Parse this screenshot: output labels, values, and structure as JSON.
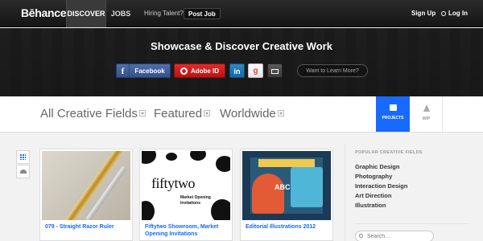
{
  "topnav": {
    "logo": "Bēhance",
    "discover": "DISCOVER",
    "jobs": "JOBS",
    "hiring": "Hiring Talent?",
    "post_job": "Post Job",
    "sign_up": "Sign Up",
    "log_in": "Log In"
  },
  "hero": {
    "title": "Showcase & Discover Creative Work",
    "facebook_glyph": "f",
    "facebook": "Facebook",
    "adobe": "Adobe ID",
    "linkedin": "in",
    "google": "g",
    "learn_more": "Want to Learn More?"
  },
  "filters": {
    "fields": "All Creative Fields",
    "featured": "Featured",
    "location": "Worldwide"
  },
  "tabs": {
    "projects": "PROJECTS",
    "wip": "WIP"
  },
  "projects": [
    {
      "title": "079 - Straight Razor Ruler"
    },
    {
      "title": "Fiftytwo Showroom, Market Opening Invitations",
      "thumb_text": "fiftytwo",
      "thumb_sub": "Market Opening Invitations"
    },
    {
      "title": "Editorial Illustrations 2012",
      "thumb_text": "ABC"
    }
  ],
  "sidebar": {
    "heading": "POPULAR CREATIVE FIELDS",
    "fields": [
      "Graphic Design",
      "Photography",
      "Interaction Design",
      "Art Direction",
      "Illustration"
    ],
    "search_placeholder": "Search..."
  },
  "colors": {
    "accent": "#1769ff",
    "facebook": "#3b5998",
    "adobe": "#cc1f1f"
  }
}
